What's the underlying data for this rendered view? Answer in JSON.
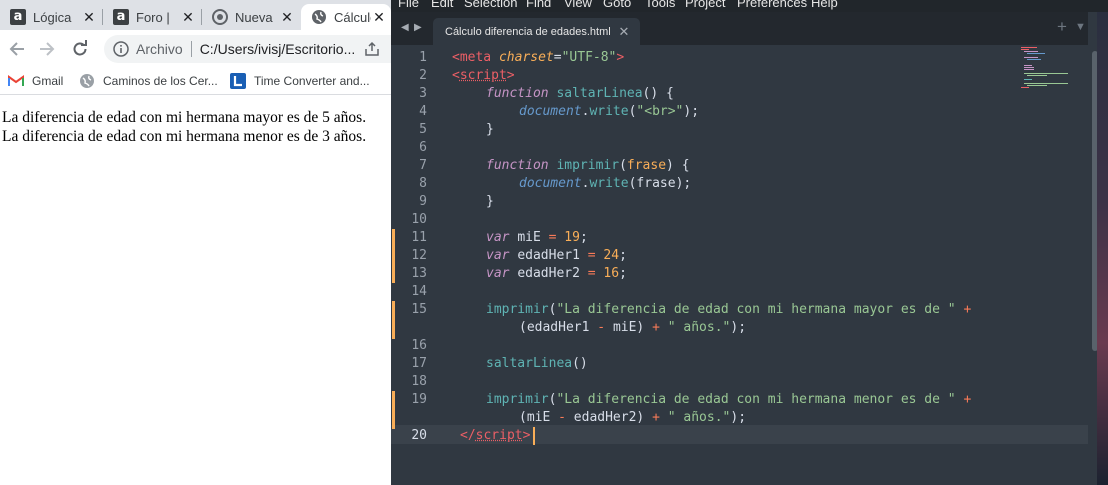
{
  "browser": {
    "tabs": [
      {
        "title": "Lógica",
        "icon": "alura-icon",
        "active": false
      },
      {
        "title": "Foro |",
        "icon": "alura-icon",
        "active": false
      },
      {
        "title": "Nueva",
        "icon": "chrome-icon",
        "active": false
      },
      {
        "title": "Cálculo",
        "icon": "globe-icon",
        "active": true
      }
    ],
    "address": {
      "scheme_label": "Archivo",
      "url": "C:/Users/ivisj/Escritorio..."
    },
    "bookmarks": [
      {
        "label": "Gmail",
        "icon": "gmail-icon"
      },
      {
        "label": "Caminos de los Cer...",
        "icon": "globe-icon"
      },
      {
        "label": "Time Converter and...",
        "icon": "time-converter-icon"
      }
    ],
    "page_lines": [
      "La diferencia de edad con mi hermana mayor es de 5 años.",
      "La diferencia de edad con mi hermana menor es de 3 años."
    ]
  },
  "editor": {
    "menu": [
      "File",
      "Edit",
      "Selection",
      "Find",
      "View",
      "Goto",
      "Tools",
      "Project",
      "Preferences",
      "Help"
    ],
    "tab_title": "Cálculo diferencia de edades.html",
    "line_numbers": [
      "1",
      "2",
      "3",
      "4",
      "5",
      "6",
      "7",
      "8",
      "9",
      "10",
      "11",
      "12",
      "13",
      "14",
      "15",
      "",
      "16",
      "17",
      "18",
      "19",
      "",
      "20"
    ],
    "current_line": "20",
    "code_tokens": {
      "meta_tag": "<meta",
      "charset_attr": "charset",
      "eq": "=",
      "utf8": "\"UTF-8\"",
      "gt": ">",
      "script_open_lt": "<",
      "script_name": "script",
      "script_close_lt": "</",
      "function_kw": "function",
      "fn_saltar": "saltarLinea",
      "fn_imprimir": "imprimir",
      "param_frase": "frase",
      "document": "document",
      "dot": ".",
      "write": "write",
      "br_str": "\"<br>\"",
      "var_kw": "var",
      "mie": "miE",
      "edadher1": "edadHer1",
      "edadher2": "edadHer2",
      "num19": "19",
      "num24": "24",
      "num16": "16",
      "str_mayor": "\"La diferencia de edad con mi hermana mayor es de \"",
      "str_menor": "\"La diferencia de edad con mi hermana menor es de \"",
      "str_anos": "\" años.\"",
      "plus": "+",
      "minus": "-",
      "lparen": "(",
      "rparen": ")",
      "semi": ";",
      "lbrace": "{",
      "rbrace": "}",
      "space": " "
    }
  },
  "colors": {
    "editor_bg": "#303841",
    "tag": "#ec5f66",
    "string": "#99c794",
    "keyword": "#c695c6",
    "function": "#5fb4b4",
    "number": "#f9ae58",
    "object": "#6699cc",
    "modified_marker": "#f9ae58"
  }
}
